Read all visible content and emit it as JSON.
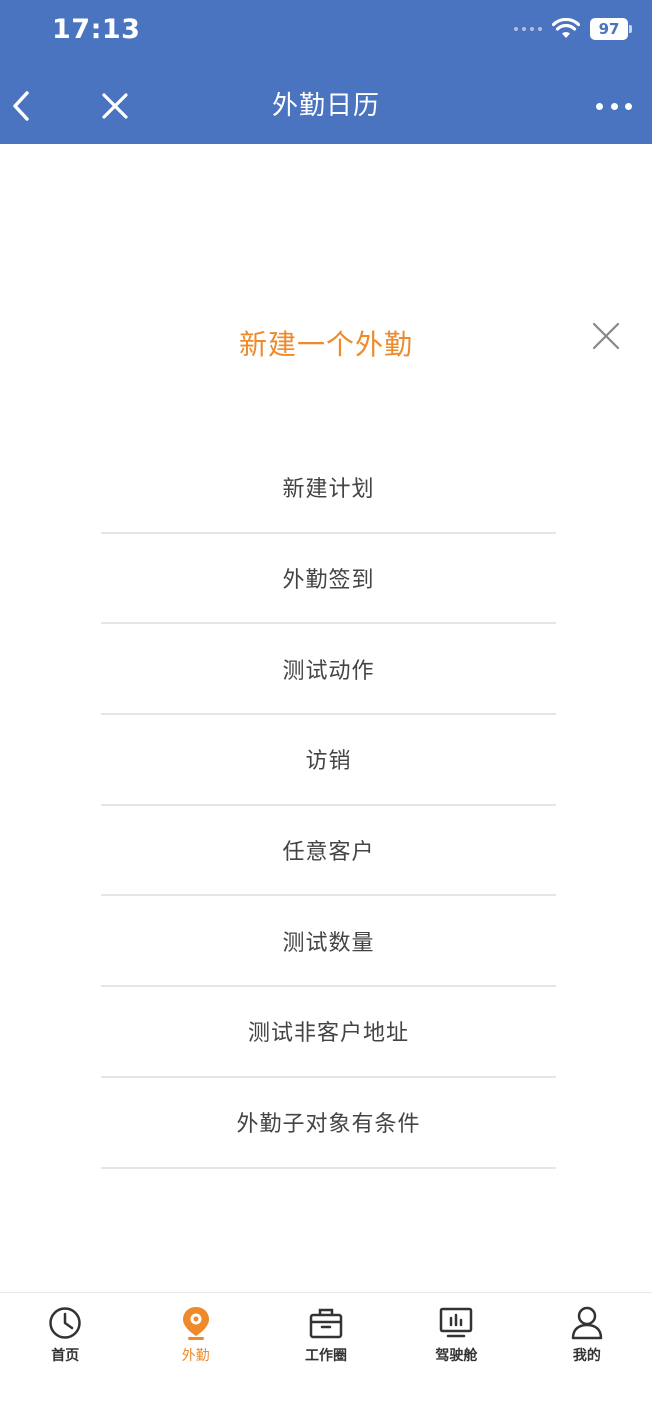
{
  "status_bar": {
    "time": "17:13",
    "battery": "97"
  },
  "nav": {
    "title": "外勤日历",
    "back_icon": "chevron-left-icon",
    "close_icon": "close-icon",
    "more_icon": "more-icon"
  },
  "sheet": {
    "title": "新建一个外勤",
    "close_icon": "close-icon",
    "items": [
      {
        "label": "新建计划"
      },
      {
        "label": "外勤签到"
      },
      {
        "label": "测试动作"
      },
      {
        "label": "访销"
      },
      {
        "label": "任意客户"
      },
      {
        "label": "测试数量"
      },
      {
        "label": "测试非客户地址"
      },
      {
        "label": "外勤子对象有条件"
      }
    ]
  },
  "tabbar": {
    "tabs": [
      {
        "label": "首页",
        "icon": "clock-icon"
      },
      {
        "label": "外勤",
        "icon": "location-pin-icon"
      },
      {
        "label": "工作圈",
        "icon": "briefcase-icon"
      },
      {
        "label": "驾驶舱",
        "icon": "dashboard-icon"
      },
      {
        "label": "我的",
        "icon": "user-icon"
      }
    ],
    "active_index": 1
  },
  "colors": {
    "header_bg": "#4a74c0",
    "accent": "#ee8a2a",
    "divider": "#e6e6e6",
    "text": "#444444"
  }
}
